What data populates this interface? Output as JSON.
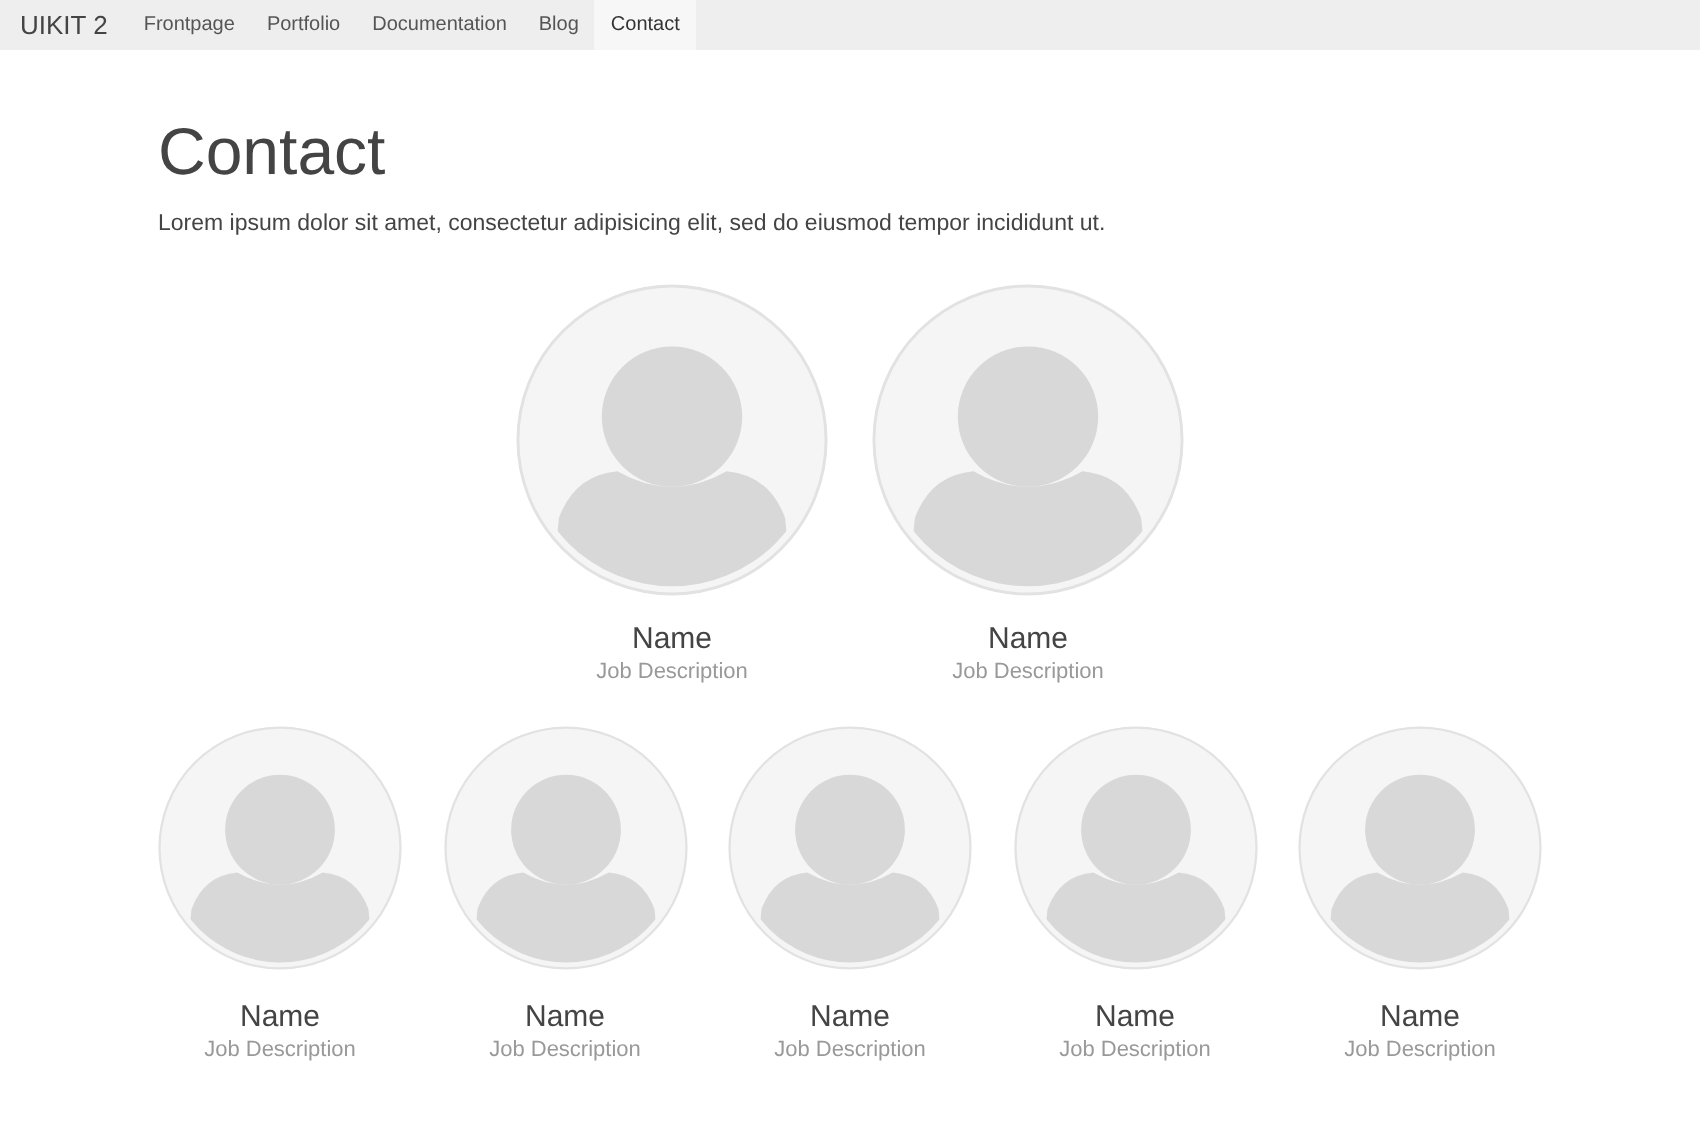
{
  "navbar": {
    "brand": "UIKIT 2",
    "items": [
      {
        "label": "Frontpage",
        "selected": false
      },
      {
        "label": "Portfolio",
        "selected": false
      },
      {
        "label": "Documentation",
        "selected": false
      },
      {
        "label": "Blog",
        "selected": false
      },
      {
        "label": "Contact",
        "selected": true
      }
    ]
  },
  "heading": "Contact",
  "intro": "Lorem ipsum dolor sit amet, consectetur adipisicing elit, sed do eiusmod tempor incididunt ut.",
  "team_rows": [
    {
      "members": [
        {
          "name": "Name",
          "role": "Job Description"
        },
        {
          "name": "Name",
          "role": "Job Description"
        }
      ]
    },
    {
      "members": [
        {
          "name": "Name",
          "role": "Job Description"
        },
        {
          "name": "Name",
          "role": "Job Description"
        },
        {
          "name": "Name",
          "role": "Job Description"
        },
        {
          "name": "Name",
          "role": "Job Description"
        },
        {
          "name": "Name",
          "role": "Job Description"
        }
      ]
    }
  ]
}
